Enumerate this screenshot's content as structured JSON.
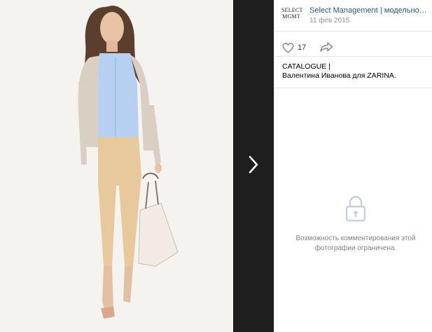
{
  "photo": {
    "alt_icon": "photo-image"
  },
  "nav": {
    "next_icon": "chevron-right-icon"
  },
  "header": {
    "logo_line1": "SELECT",
    "logo_line2": "MGMT",
    "group_name": "Select Management | модельное а...",
    "date": "11 фев 2015"
  },
  "actions": {
    "like_icon": "heart-icon",
    "like_count": "17",
    "share_icon": "share-arrow-icon"
  },
  "caption": {
    "line1": "CATALOGUE |",
    "line2": "Валентина Иванова для ZARINA."
  },
  "comments": {
    "lock_icon": "lock-icon",
    "note": "Возможность комментирования этой фотографии ограничена."
  },
  "colors": {
    "link": "#2a5885",
    "muted": "#939393",
    "note": "#828282",
    "strip": "#1e1e1e",
    "divider": "#e7e8ec"
  }
}
